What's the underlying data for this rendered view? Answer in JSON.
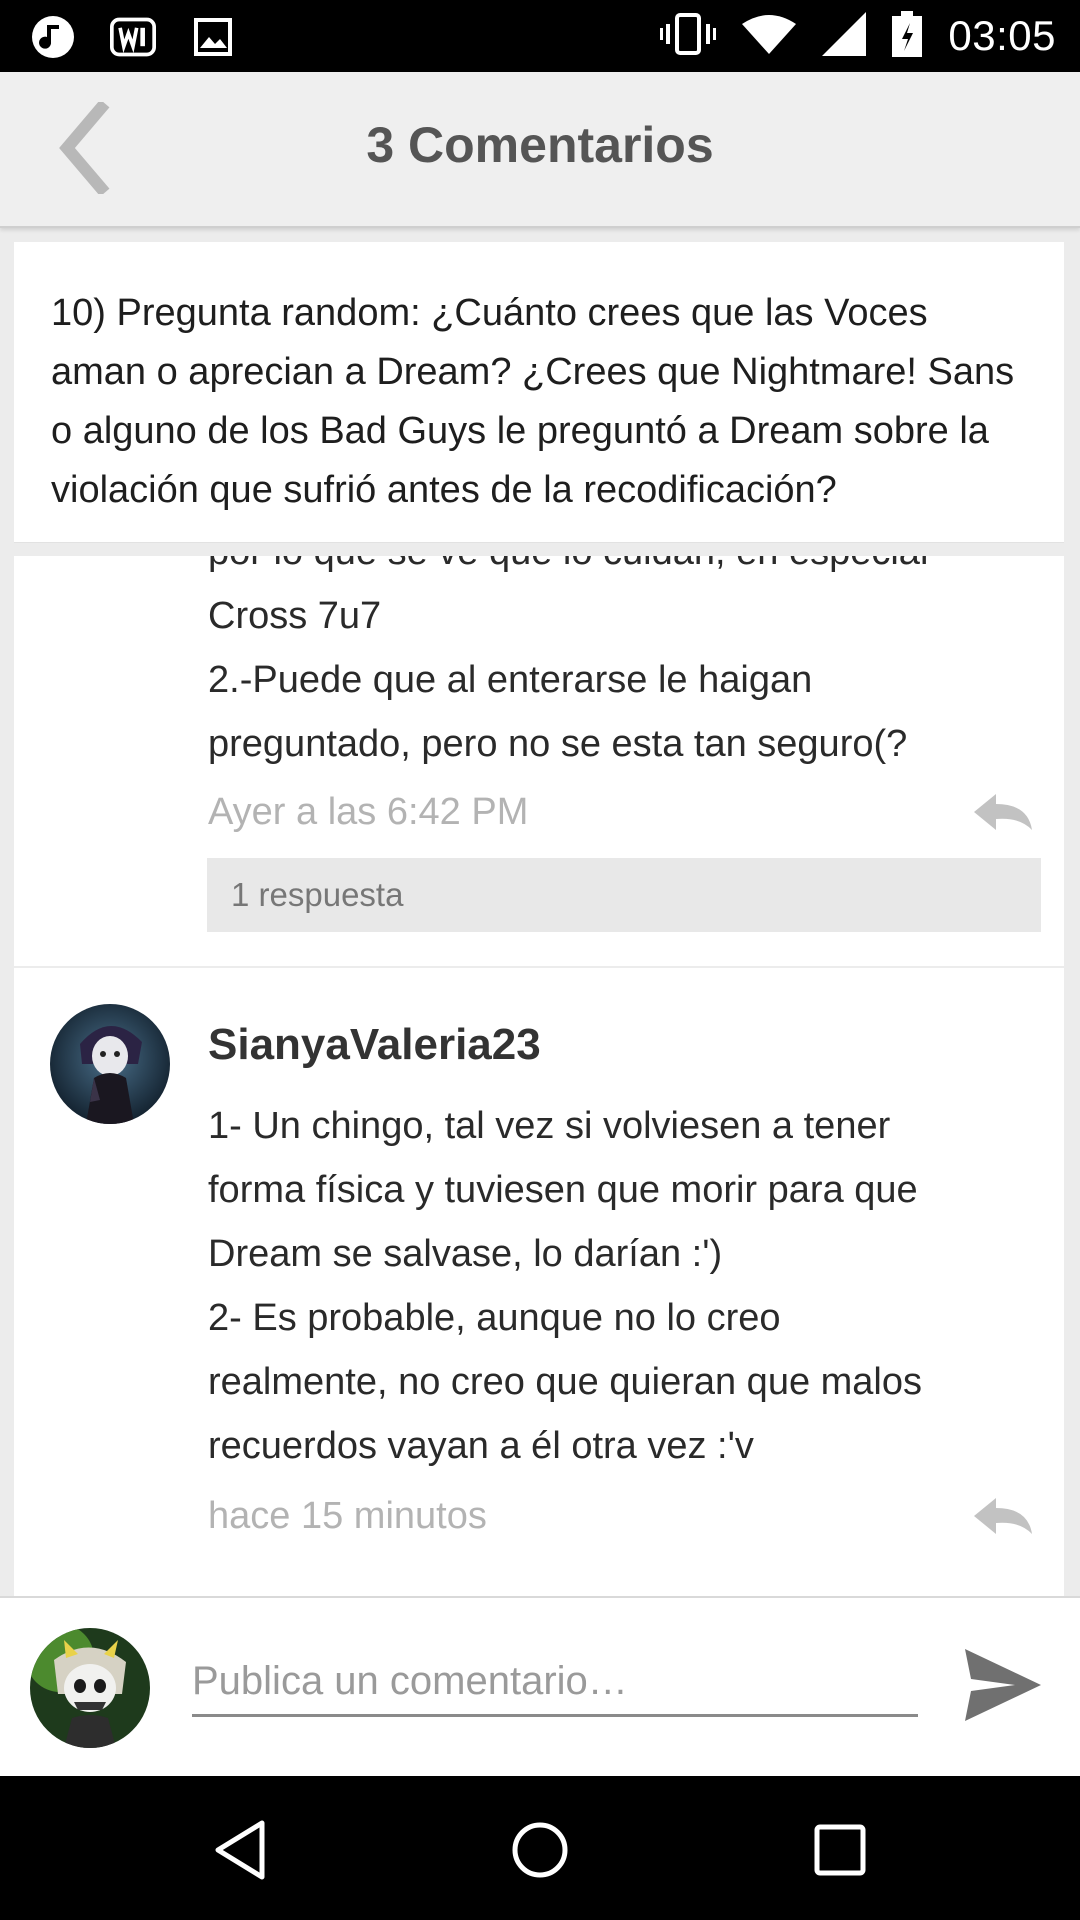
{
  "status_bar": {
    "time": "03:05",
    "left_icons": [
      "music-note-icon",
      "wattpad-icon",
      "image-icon"
    ],
    "right_icons": [
      "vibrate-icon",
      "wifi-icon",
      "signal-icon",
      "battery-icon"
    ]
  },
  "app_bar": {
    "title": "3 Comentarios",
    "back_icon": "chevron-left-icon"
  },
  "question": {
    "text": "10) Pregunta random: ¿Cuánto crees que las Voces aman o aprecian a Dream? ¿Crees que Nightmare! Sans o alguno de los Bad Guys le preguntó a Dream sobre la violación que sufrió antes de la recodificación?"
  },
  "comments": [
    {
      "text_lines": [
        "por lo que se ve que lo cuidan, en especial",
        "Cross 7u7",
        "2.-Puede que al enterarse le haigan",
        "preguntado, pero no se esta tan seguro(?"
      ],
      "time": "Ayer a las 6:42 PM",
      "replies_label": "1 respuesta"
    },
    {
      "username": "SianyaValeria23",
      "text_lines": [
        "1- Un chingo, tal vez si volviesen a tener",
        "forma física y tuviesen que morir para que",
        "Dream se salvase, lo darían :')",
        "2- Es probable, aunque no lo creo",
        "realmente, no creo que quieran que malos",
        "recuerdos vayan a él otra vez :'v"
      ],
      "time": "hace 15 minutos"
    }
  ],
  "composer": {
    "placeholder": "Publica un comentario…",
    "send_icon": "send-icon"
  },
  "nav_bar": {
    "icons": [
      "back-triangle-icon",
      "home-circle-icon",
      "recents-square-icon"
    ]
  },
  "colors": {
    "status_bar": "#000000",
    "app_bar": "#efefef",
    "background": "#ececec",
    "muted_text": "#b3b3b3"
  }
}
